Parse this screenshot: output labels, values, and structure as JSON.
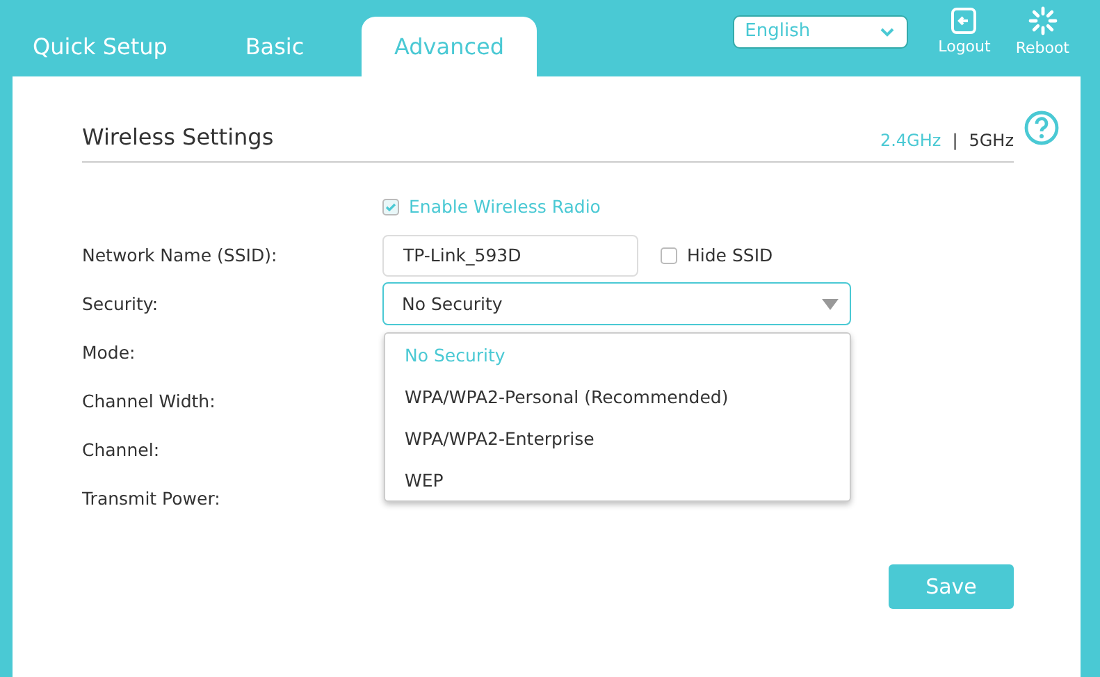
{
  "tabs": [
    {
      "label": "Quick Setup",
      "selected": false
    },
    {
      "label": "Basic",
      "selected": false
    },
    {
      "label": "Advanced",
      "selected": true
    }
  ],
  "language": {
    "value": "English"
  },
  "header_actions": [
    {
      "label": "Logout",
      "kind": "logout"
    },
    {
      "label": "Reboot",
      "kind": "reboot"
    }
  ],
  "section": {
    "title": "Wireless Settings",
    "bands": [
      {
        "label": "2.4GHz",
        "selected": true
      },
      {
        "label": "5GHz",
        "selected": false
      }
    ],
    "separator": "|"
  },
  "enable_radio": {
    "label": "Enable Wireless Radio",
    "checked": true
  },
  "ssid": {
    "label": "Network Name (SSID):",
    "value": "TP-Link_593D",
    "hide_ssid": {
      "label": "Hide SSID",
      "checked": false
    }
  },
  "security": {
    "label": "Security:",
    "value": "No Security",
    "expanded": true,
    "options": [
      {
        "label": "No Security",
        "selected": true
      },
      {
        "label": "WPA/WPA2-Personal (Recommended)",
        "selected": false
      },
      {
        "label": "WPA/WPA2-Enterprise",
        "selected": false
      },
      {
        "label": "WEP",
        "selected": false
      }
    ]
  },
  "other_labels": [
    "Mode:",
    "Channel Width:",
    "Channel:",
    "Transmit Power:"
  ],
  "save_button": "Save"
}
